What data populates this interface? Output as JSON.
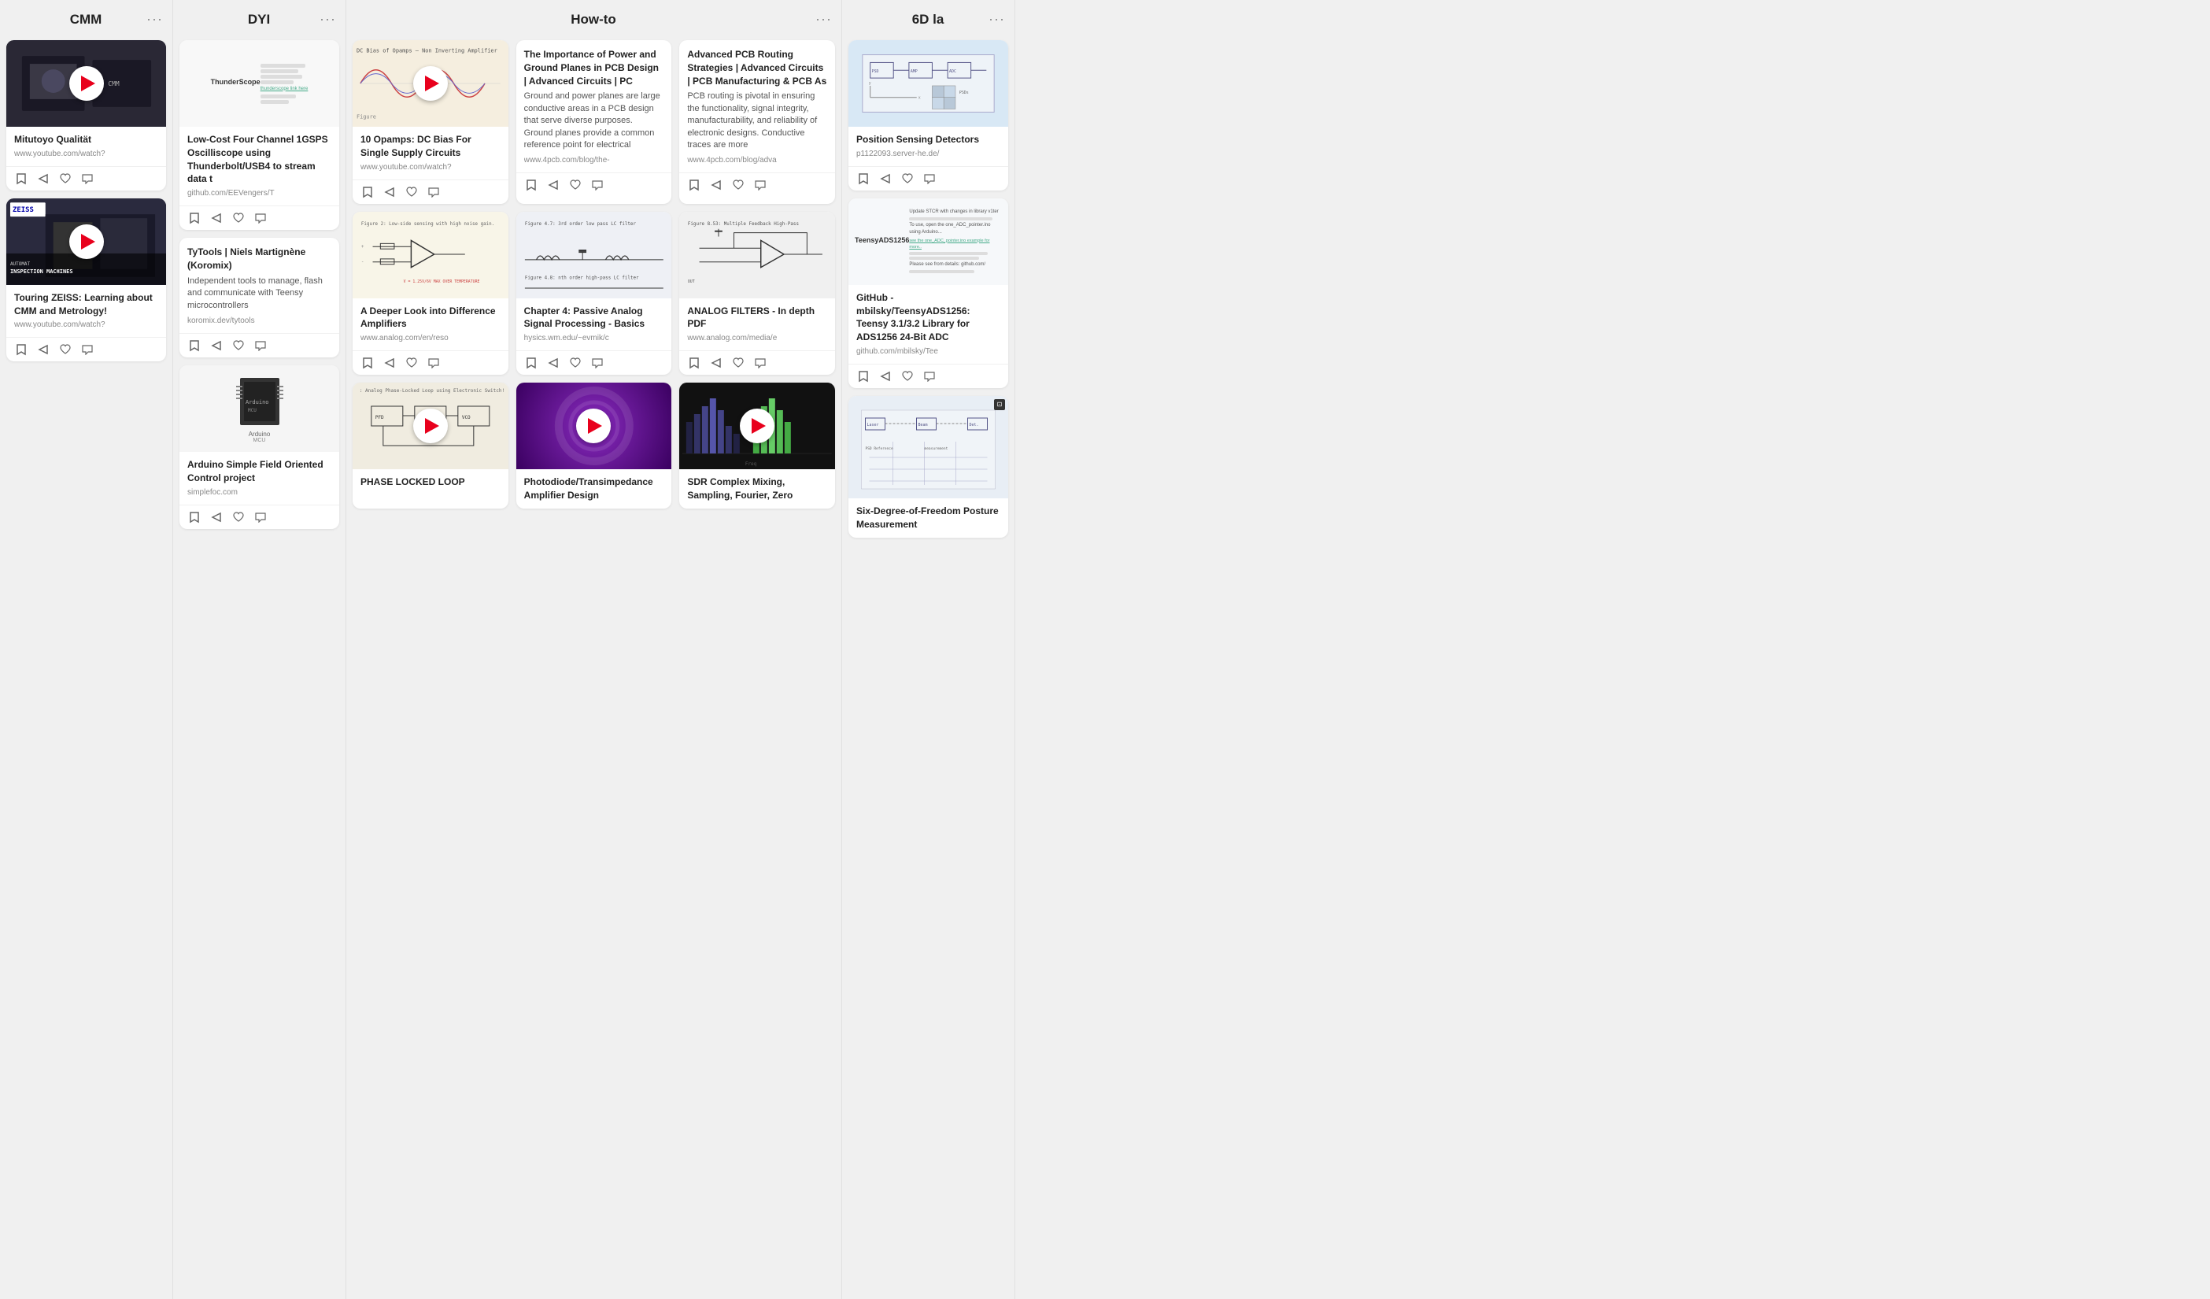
{
  "columns": [
    {
      "id": "cmm",
      "title": "CMM",
      "cards": [
        {
          "id": "cmm-1",
          "type": "video",
          "thumbType": "dark-machine",
          "title": "Mitutoyo Qualität",
          "description": "",
          "url": "www.youtube.com/watch?",
          "hasPlayButton": true
        },
        {
          "id": "cmm-2",
          "type": "video",
          "thumbType": "zeiss",
          "title": "Touring ZEISS: Learning about CMM and Metrology!",
          "description": "",
          "url": "www.youtube.com/watch?",
          "hasPlayButton": true
        }
      ]
    },
    {
      "id": "dyi",
      "title": "DYI",
      "cards": [
        {
          "id": "dyi-1",
          "type": "doc",
          "thumbType": "doc",
          "title": "Low-Cost Four Channel 1GSPS Oscilliscope using Thunderbolt/USB4 to stream data t",
          "description": "",
          "url": "github.com/EEVengers/T"
        },
        {
          "id": "dyi-2",
          "type": "doc",
          "thumbType": "doc-tytools",
          "title": "TyTools | Niels Martignène (Koromix)",
          "description": "Independent tools to manage, flash and communicate with Teensy microcontrollers",
          "url": "koromix.dev/tytools"
        },
        {
          "id": "dyi-3",
          "type": "doc",
          "thumbType": "arduino",
          "title": "Arduino Simple Field Oriented Control project",
          "description": "",
          "url": "simplefoc.com"
        }
      ]
    },
    {
      "id": "howto",
      "title": "How-to",
      "cards": [
        {
          "id": "howto-1",
          "type": "video",
          "thumbType": "waveform",
          "title": "10 Opamps: DC Bias For Single Supply Circuits",
          "description": "",
          "url": "www.youtube.com/watch?",
          "hasPlayButton": true
        },
        {
          "id": "howto-2",
          "type": "doc",
          "thumbType": "doc-pcb",
          "title": "The Importance of Power and Ground Planes in PCB Design | Advanced Circuits | PC",
          "description": "Ground and power planes are large conductive areas in a PCB design that serve diverse purposes. Ground planes provide a common reference point for electrical",
          "url": "www.4pcb.com/blog/the-"
        },
        {
          "id": "howto-3",
          "type": "doc",
          "thumbType": "doc-pcb2",
          "title": "Advanced PCB Routing Strategies | Advanced Circuits | PCB Manufacturing & PCB As",
          "description": "PCB routing is pivotal in ensuring the functionality, signal integrity, manufacturability, and reliability of electronic designs. Conductive traces are more",
          "url": "www.4pcb.com/blog/adva"
        },
        {
          "id": "howto-4",
          "type": "doc",
          "thumbType": "diff-amp",
          "title": "A Deeper Look into Difference Amplifiers",
          "description": "",
          "url": "www.analog.com/en/reso"
        },
        {
          "id": "howto-5",
          "type": "doc",
          "thumbType": "passive-analog",
          "title": "Chapter 4: Passive Analog Signal Processing - Basics",
          "description": "",
          "url": "hysics.wm.edu/~evmik/c"
        },
        {
          "id": "howto-6",
          "type": "doc",
          "thumbType": "analog-filters",
          "title": "ANALOG FILTERS - In depth PDF",
          "description": "",
          "url": "www.analog.com/media/e"
        },
        {
          "id": "howto-7",
          "type": "video",
          "thumbType": "pll",
          "title": "PHASE LOCKED LOOP",
          "description": "",
          "url": "",
          "hasPlayButton": true,
          "partial": true
        },
        {
          "id": "howto-8",
          "type": "video",
          "thumbType": "photodiode",
          "title": "Photodiode/Transimpedance Amplifier Design",
          "description": "",
          "url": "",
          "hasPlayButton": true,
          "partial": true
        },
        {
          "id": "howto-9",
          "type": "video",
          "thumbType": "sdr",
          "title": "SDR Complex Mixing, Sampling, Fourier, Zero",
          "description": "",
          "url": "",
          "hasPlayButton": true,
          "partial": true
        }
      ]
    },
    {
      "id": "6d",
      "title": "6D la",
      "cards": [
        {
          "id": "6d-1",
          "type": "doc",
          "thumbType": "position-sensing",
          "title": "Position Sensing Detectors",
          "description": "",
          "url": "p1122093.server-he.de/"
        },
        {
          "id": "6d-2",
          "type": "doc",
          "thumbType": "github-teensy",
          "title": "GitHub - mbilsky/TeensyADS1256: Teensy 3.1/3.2 Library for ADS1256 24-Bit ADC",
          "description": "",
          "url": "github.com/mbilsky/Tee"
        },
        {
          "id": "6d-3",
          "type": "doc",
          "thumbType": "six-dof",
          "title": "Six-Degree-of-Freedom Posture Measurement",
          "description": "",
          "url": "",
          "partial": true
        }
      ]
    }
  ],
  "actions": {
    "bookmark": "🔖",
    "share": "➤",
    "like": "♡",
    "comment": "💬"
  },
  "menu_dots": "···"
}
